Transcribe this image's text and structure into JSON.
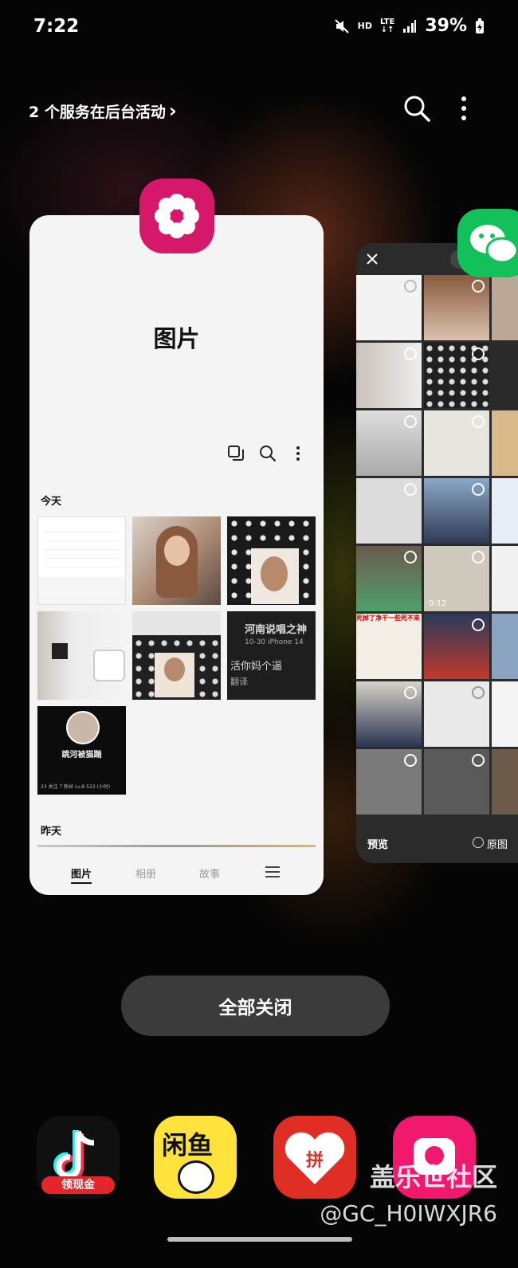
{
  "status_bar": {
    "time": "7:22",
    "hd": "HD",
    "lte": "LTE",
    "battery": "39%"
  },
  "recents_header": {
    "background_services": "2 个服务在后台活动",
    "chevron": "›"
  },
  "gallery_card": {
    "app_name": "图片",
    "sections": {
      "today": "今天",
      "yesterday": "昨天"
    },
    "thumb_text": {
      "song_title": "河南说唱之神",
      "song_meta": "10-30  iPhone 14",
      "song_line": "活你妈个逼",
      "song_translate": "翻译",
      "profile_name": "跳河被猫踹",
      "profile_stats": "23 关注   7 粉丝   Lv.8   523 (小时)"
    },
    "tabs": [
      "图片",
      "相册",
      "故事"
    ],
    "active_tab": "图片"
  },
  "wechat_card": {
    "preview": "预览",
    "original": "原图",
    "video_duration": "0:12",
    "cell_text": {
      "meme": "死掉了净干一些死不来"
    }
  },
  "close_all": "全部关闭",
  "watermark": {
    "site": "盖乐世社区",
    "handle": "@GC_H0IWXJR6"
  },
  "dock": {
    "douyin_badge": "领现金",
    "xianyu_text": "闲鱼",
    "pdd_text": "拼"
  },
  "colors": {
    "gallery_brand": "#d6186b",
    "wechat_brand": "#12c15a",
    "close_all_bg": "#3b3b3b"
  }
}
